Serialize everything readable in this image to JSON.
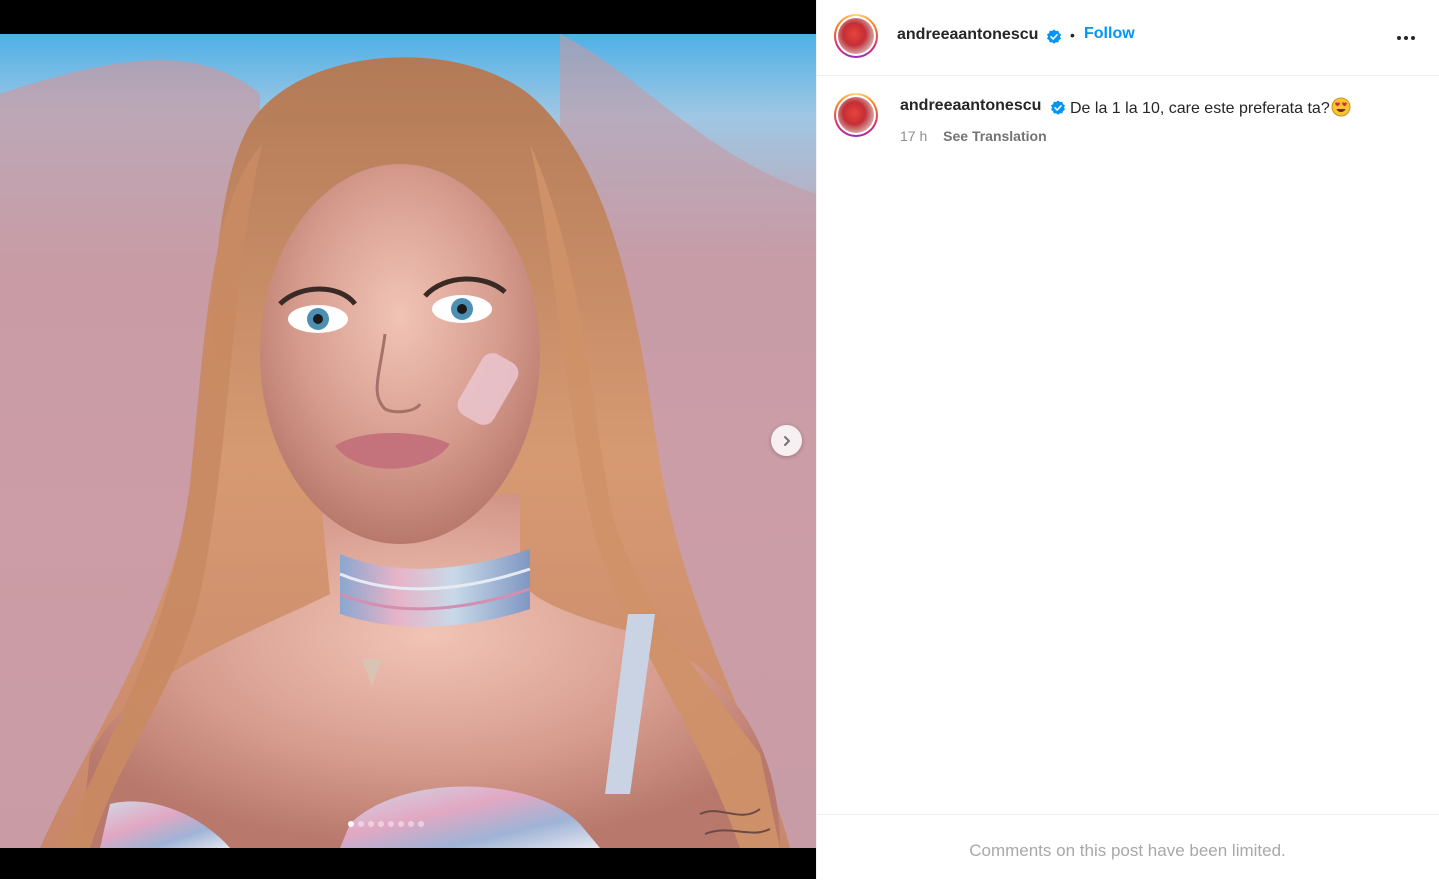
{
  "post": {
    "username": "andreeaantonescu",
    "follow_label": "Follow",
    "separator": "•",
    "caption": "De la 1 la 10, care este preferata ta?",
    "time_ago": "17 h",
    "see_translation": "See Translation",
    "comments_limited": "Comments on this post have been limited."
  },
  "carousel": {
    "dot_count": 8,
    "active_index": 0
  },
  "icons": {
    "verified": "verified-badge-icon",
    "more": "more-options-icon",
    "next": "chevron-right-icon",
    "emoji": "heart-eyes-emoji"
  },
  "colors": {
    "accent": "#0095f6",
    "verified": "#0095f6",
    "secondary_text": "#8e8e8e",
    "muted_text": "#a8a8a8"
  }
}
